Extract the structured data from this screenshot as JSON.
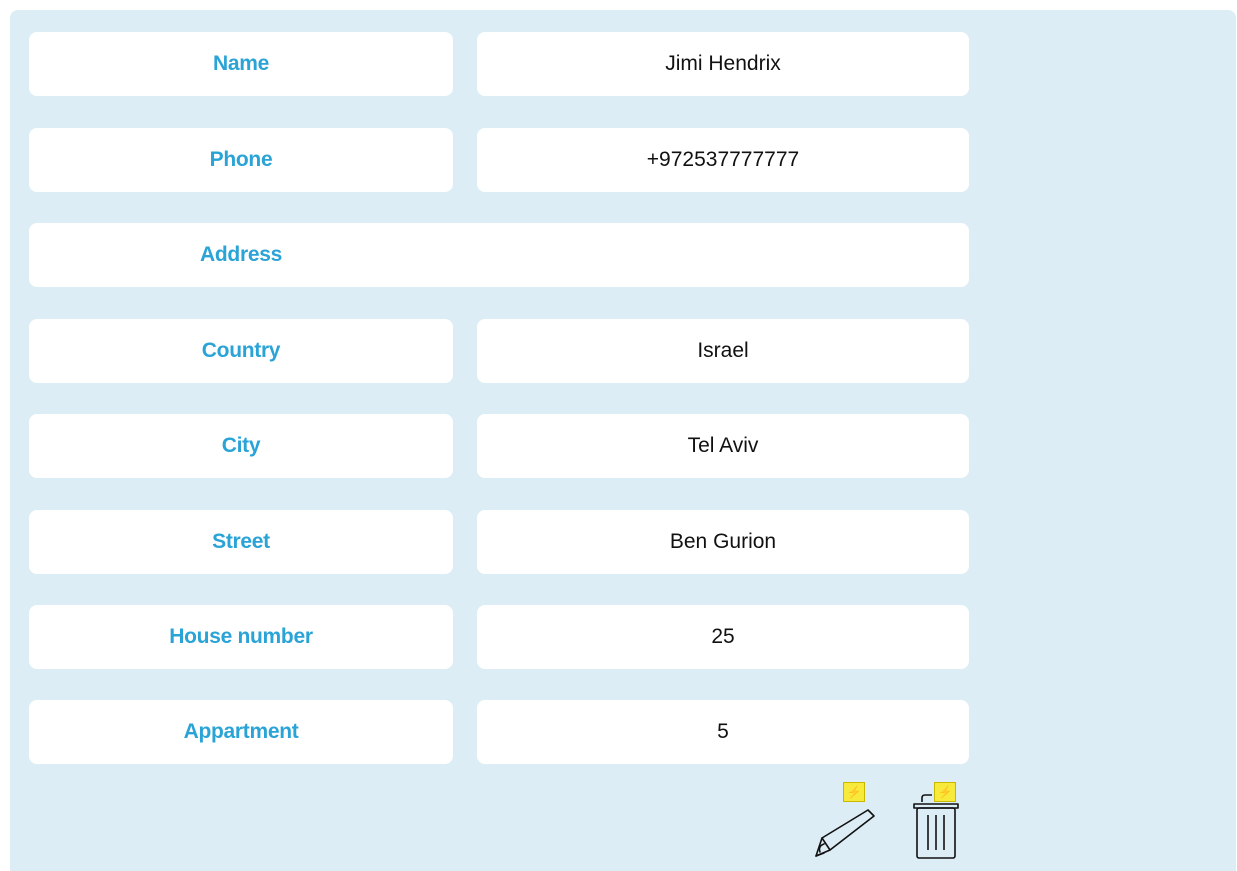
{
  "fields": {
    "name": {
      "label": "Name",
      "value": "Jimi Hendrix"
    },
    "phone": {
      "label": "Phone",
      "value": "+972537777777"
    },
    "address": {
      "label": "Address"
    },
    "country": {
      "label": "Country",
      "value": "Israel"
    },
    "city": {
      "label": "City",
      "value": "Tel Aviv"
    },
    "street": {
      "label": "Street",
      "value": "Ben Gurion"
    },
    "house_number": {
      "label": "House number",
      "value": "25"
    },
    "appartment": {
      "label": "Appartment",
      "value": "5"
    }
  },
  "actions": {
    "badge_glyph": "⚡",
    "icons": {
      "edit": "pencil-icon",
      "delete": "trash-icon",
      "badge": "lightning-icon"
    }
  },
  "colors": {
    "panel_bg": "#dcedf5",
    "label": "#2aa3d6",
    "badge": "#f7ea3a"
  }
}
